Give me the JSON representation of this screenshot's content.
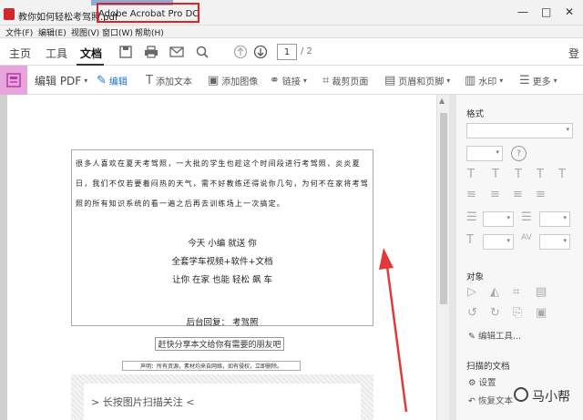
{
  "window": {
    "file_name": "教你如何轻松考驾照.pdf",
    "app_title": "Adobe Acrobat Pro DC",
    "minimize": "—",
    "maximize": "□",
    "close": "✕"
  },
  "menu": [
    "文件(F)",
    "编辑(E)",
    "视图(V)",
    "窗口(W)",
    "帮助(H)"
  ],
  "tabs": [
    "主页",
    "工具",
    "文档"
  ],
  "nav": {
    "current_page": "1",
    "total_pages": "/ 2"
  },
  "login_label": "登",
  "edit_toolbar": {
    "edit_pdf": "编辑 PDF",
    "items": [
      "编辑",
      "添加文本",
      "添加图像",
      "链接",
      "裁剪页面",
      "页眉和页脚",
      "水印",
      "更多"
    ]
  },
  "document": {
    "paragraph": "很多人喜欢在夏天考驾照，一大批的学生也趁这个时间段进行考驾照，炎炎夏日，我们不仅若要着闷热的天气，需不好教练还得说你几句，为何不在家将考驾照的所有知识系统的看一遍之后再去训练场上一次搞定。",
    "center_lines": [
      "今天 小编 就送 你",
      "全套学车视频+软件+文档",
      "让你 在家 也能 轻松 飙 车"
    ],
    "reply_line": "后台回复：  考驾照",
    "share_line": "赶快分享本文给你有需要的朋友吧",
    "disclaimer": "声明：所有资源，素材均来自网络，如有侵权，立即删除。",
    "qr_prompt": "> 长按图片扫描关注 <"
  },
  "right_panel": {
    "format_heading": "格式",
    "object_heading": "对象",
    "edit_tools_label": "编辑工具...",
    "scanned_heading": "扫描的文档",
    "settings_label": "设置",
    "restore_label": "恢复文本"
  },
  "watermark": "马小帮"
}
